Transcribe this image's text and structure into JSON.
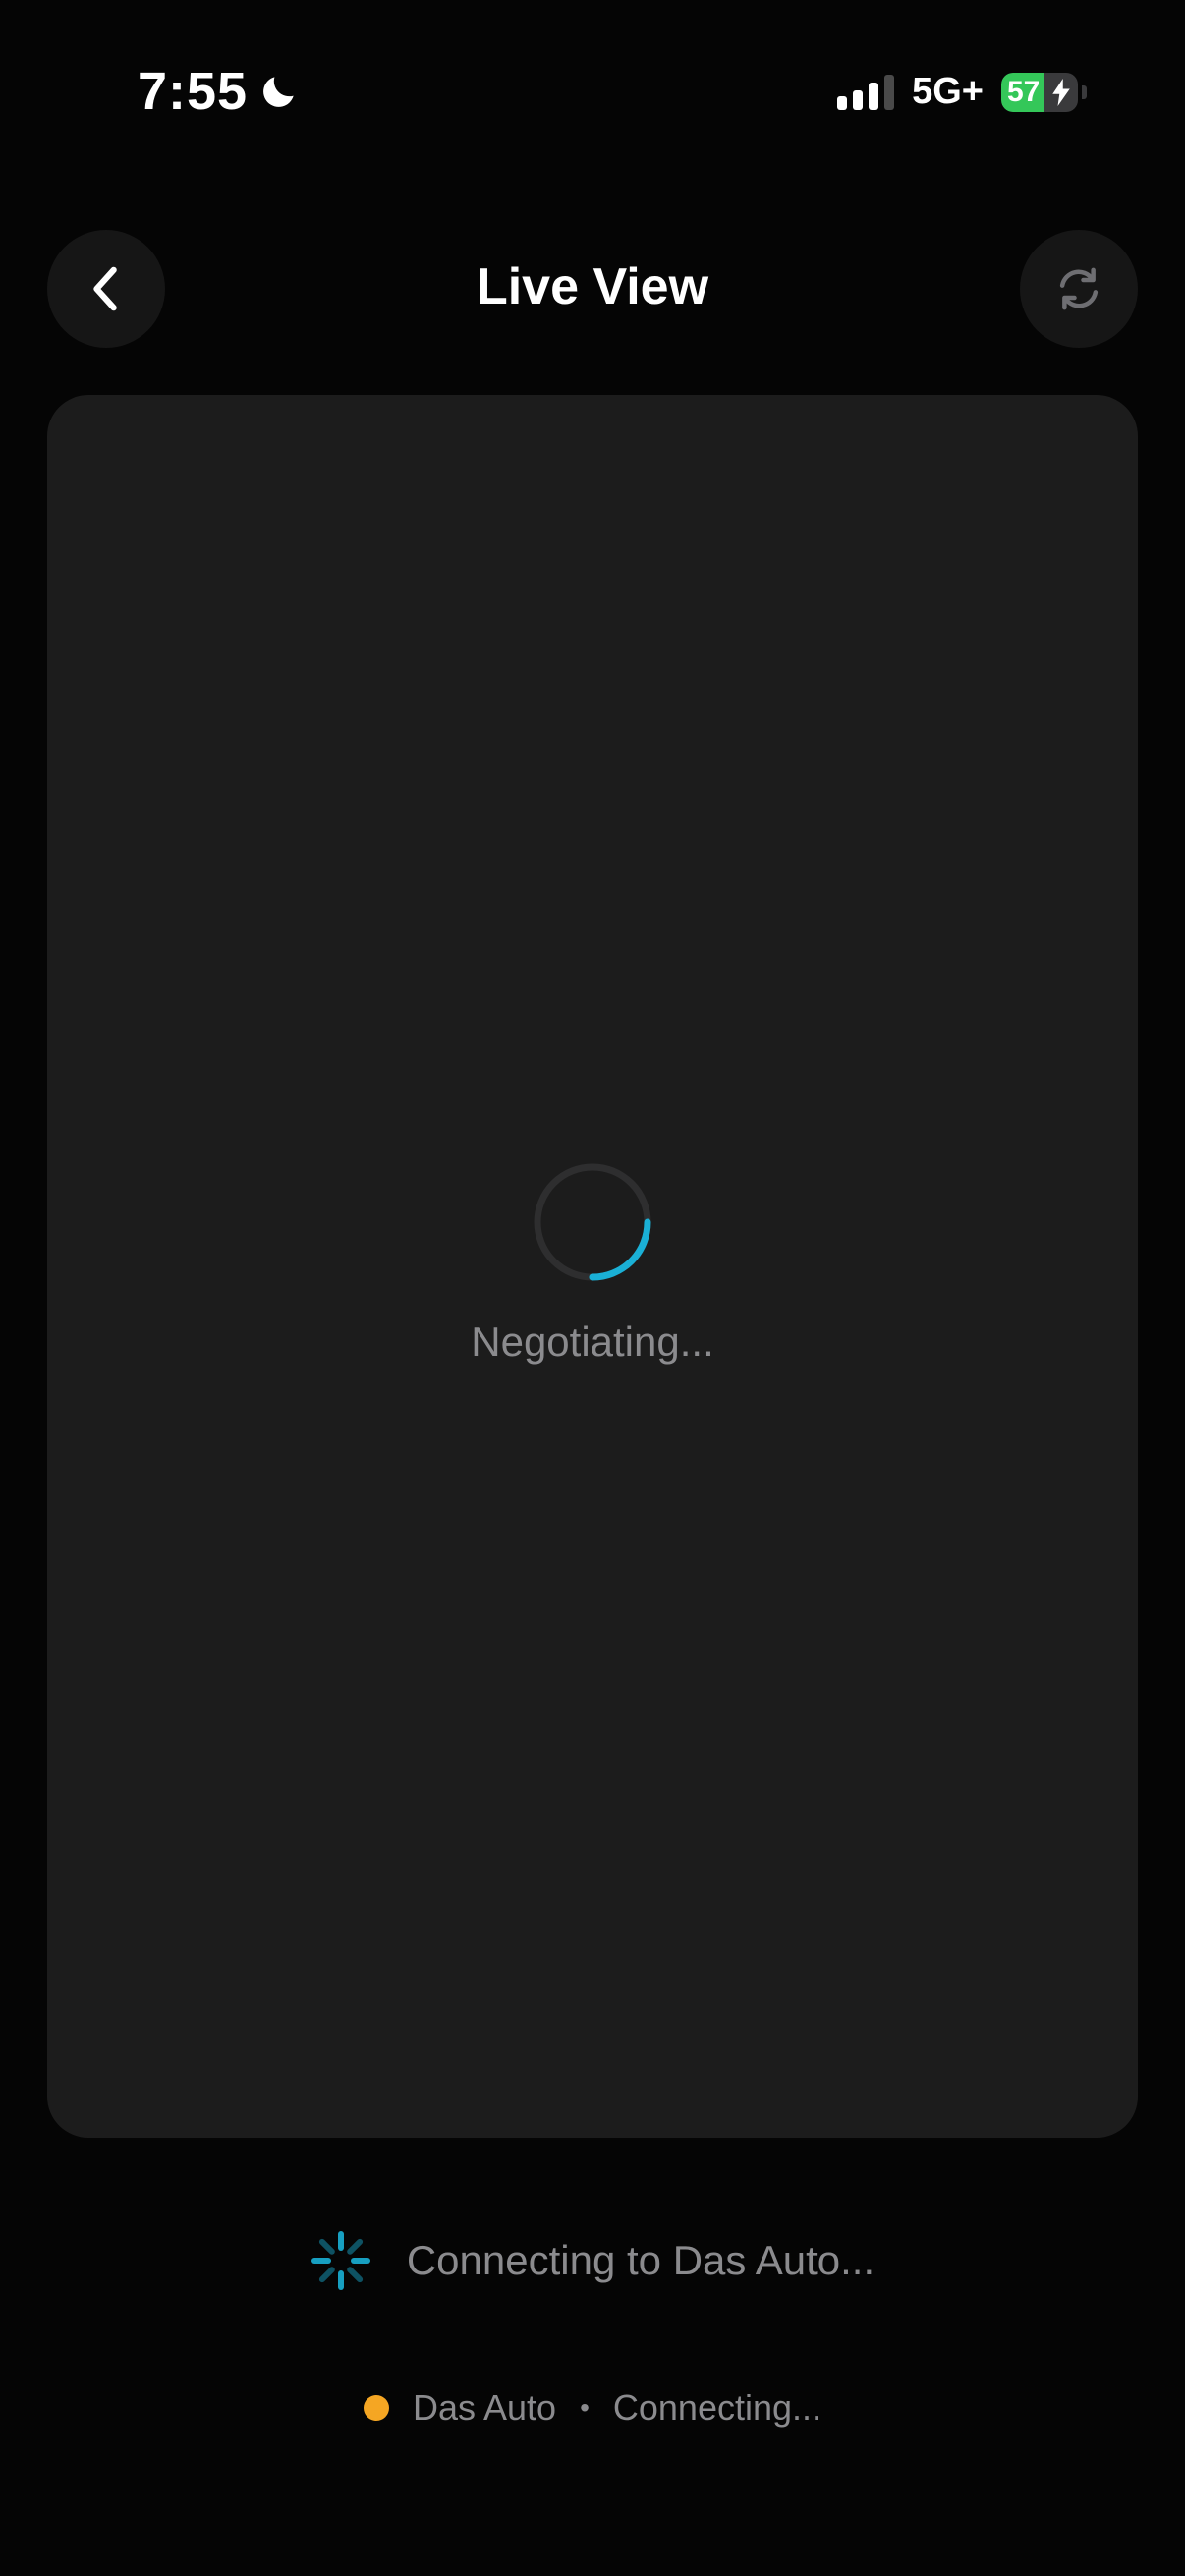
{
  "status_bar": {
    "time": "7:55",
    "network": "5G+",
    "battery_level": "57",
    "battery_percent": 57,
    "icons": [
      "moon-icon",
      "signal-icon",
      "bolt-icon"
    ]
  },
  "header": {
    "title": "Live View",
    "back_icon": "chevron-left-icon",
    "refresh_icon": "refresh-icon"
  },
  "video_panel": {
    "loading_text": "Negotiating...",
    "spinner_progress": 0.25
  },
  "connection": {
    "message": "Connecting to Das Auto...",
    "device_name": "Das Auto",
    "separator": "•",
    "device_status": "Connecting..."
  },
  "colors": {
    "background": "#050505",
    "panel": "#1c1c1c",
    "accent": "#1ab0d6",
    "status_dot": "#f5a623",
    "muted_text": "#8b8b8e",
    "battery_green": "#34c759"
  }
}
